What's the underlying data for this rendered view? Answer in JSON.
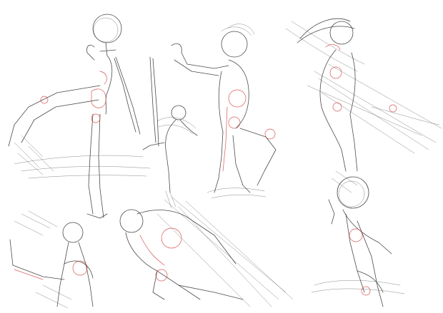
{
  "image": {
    "background": "#ffffff",
    "colors": {
      "pencil": "#2b2b2b",
      "construction": "#d23a3a"
    },
    "content": "gesture-sketch-sheet"
  }
}
